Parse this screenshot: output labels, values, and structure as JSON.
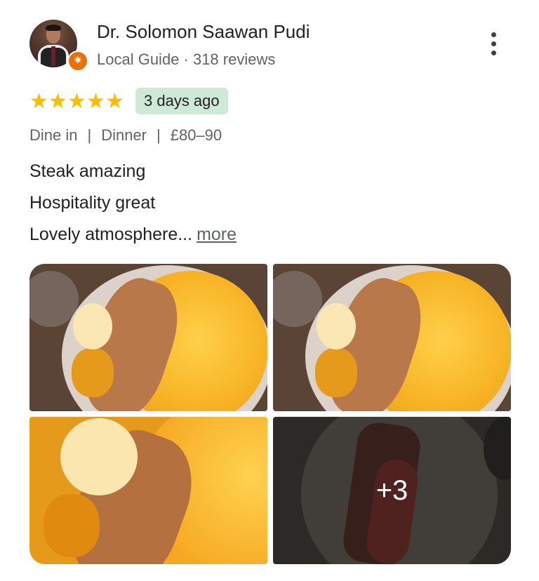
{
  "reviewer": {
    "name": "Dr. Solomon Saawan Pudi",
    "subtitle": "Local Guide · 318 reviews",
    "badge_icon": "local-guide-star"
  },
  "review": {
    "rating": 5,
    "time_ago": "3 days ago",
    "meta": [
      "Dine in",
      "Dinner",
      "£80–90"
    ],
    "lines": [
      "Steak amazing",
      "Hospitality great",
      "Lovely atmosphere..."
    ],
    "more_label": "more"
  },
  "photos": {
    "extra_count": "+3"
  },
  "colors": {
    "star": "#fbbc04",
    "chip_bg": "#ceead6",
    "badge": "#e8710a"
  }
}
